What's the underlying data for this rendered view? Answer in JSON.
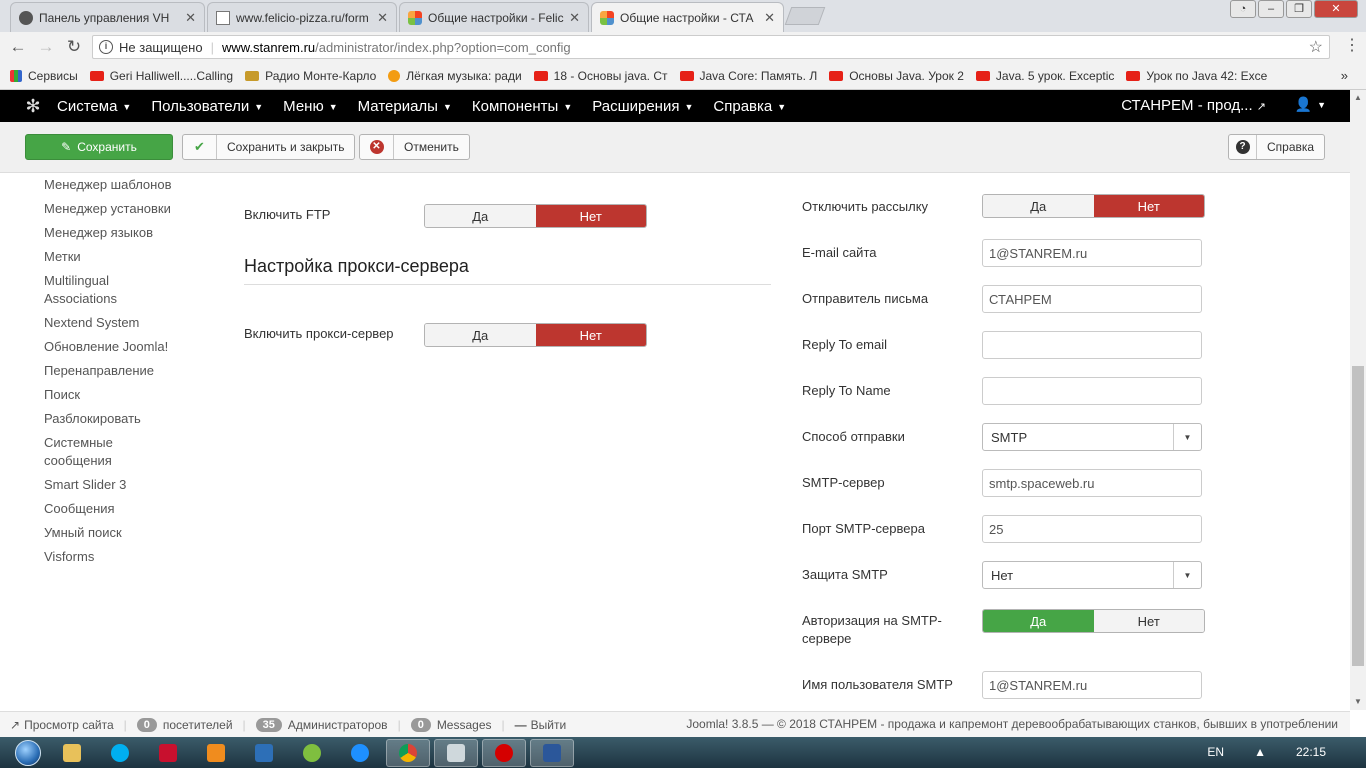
{
  "browser": {
    "tabs": [
      {
        "title": "Панель управления VH",
        "icon": "gear-icon",
        "active": false
      },
      {
        "title": "www.felicio-pizza.ru/form",
        "icon": "page-icon",
        "active": false
      },
      {
        "title": "Общие настройки - Felic",
        "icon": "joomla-icon",
        "active": false
      },
      {
        "title": "Общие настройки - СТА",
        "icon": "joomla-icon",
        "active": true
      }
    ],
    "address": {
      "security_label": "Не защищено",
      "host": "www.stanrem.ru",
      "path": "/administrator/index.php?option=com_config"
    },
    "bookmarks": [
      {
        "label": "Сервисы",
        "icon": "apps-icon"
      },
      {
        "label": "Geri Halliwell.....Calling",
        "icon": "youtube-icon"
      },
      {
        "label": "Радио Монте-Карло",
        "icon": "crown-icon"
      },
      {
        "label": "Лёгкая музыка: ради",
        "icon": "music-icon"
      },
      {
        "label": "18 - Основы java. Ст",
        "icon": "youtube-icon"
      },
      {
        "label": "Java Core: Память. Л",
        "icon": "youtube-icon"
      },
      {
        "label": "Основы Java. Урок 2",
        "icon": "youtube-icon"
      },
      {
        "label": "Java. 5 урок. Exceptic",
        "icon": "youtube-icon"
      },
      {
        "label": "Урок по Java 42: Exce",
        "icon": "youtube-icon"
      }
    ],
    "bookmarks_more": "»"
  },
  "joomla": {
    "menu": [
      "Система",
      "Пользователи",
      "Меню",
      "Материалы",
      "Компоненты",
      "Расширения",
      "Справка"
    ],
    "site_name": "СТАНРЕМ - прод...",
    "toolbar": {
      "save": "Сохранить",
      "save_close": "Сохранить и закрыть",
      "cancel": "Отменить",
      "help": "Справка"
    },
    "sidebar": [
      "Менеджер шаблонов",
      "Менеджер установки",
      "Менеджер языков",
      "Метки",
      "Multilingual Associations",
      "Nextend System",
      "Обновление Joomla!",
      "Перенаправление",
      "Поиск",
      "Разблокировать",
      "Системные сообщения",
      "Smart Slider 3",
      "Сообщения",
      "Умный поиск",
      "Visforms"
    ],
    "ftp": {
      "label": "Включить FTP",
      "yes": "Да",
      "no": "Нет",
      "value": "Нет"
    },
    "proxy_section_title": "Настройка прокси-сервера",
    "proxy": {
      "label": "Включить прокси-сервер",
      "yes": "Да",
      "no": "Нет",
      "value": "Нет"
    },
    "mail": {
      "disable_mail": {
        "label": "Отключить рассылку",
        "yes": "Да",
        "no": "Нет",
        "value": "Нет"
      },
      "site_email": {
        "label": "E-mail сайта",
        "value": "1@STANREM.ru"
      },
      "from_name": {
        "label": "Отправитель письма",
        "value": "СТАНРЕМ"
      },
      "reply_to_email": {
        "label": "Reply To email",
        "value": ""
      },
      "reply_to_name": {
        "label": "Reply To Name",
        "value": ""
      },
      "mailer": {
        "label": "Способ отправки",
        "value": "SMTP"
      },
      "smtp_host": {
        "label": "SMTP-сервер",
        "value": "smtp.spaceweb.ru"
      },
      "smtp_port": {
        "label": "Порт SMTP-сервера",
        "value": "25"
      },
      "smtp_secure": {
        "label": "Защита SMTP",
        "value": "Нет"
      },
      "smtp_auth": {
        "label_1": "Авторизация на SMTP-",
        "label_2": "сервере",
        "yes": "Да",
        "no": "Нет",
        "value": "Да"
      },
      "smtp_user": {
        "label": "Имя пользователя SMTP",
        "value": "1@STANREM.ru"
      }
    },
    "status": {
      "view_site": "Просмотр сайта",
      "visitors_count": "0",
      "visitors_label": "посетителей",
      "admins_count": "35",
      "admins_label": "Администраторов",
      "messages_count": "0",
      "messages_label": "Messages",
      "logout": "Выйти",
      "footer": "Joomla! 3.8.5  —  © 2018 СТАНРЕМ - продажа и капремонт деревообрабатывающих станков, бывших в употреблении"
    }
  },
  "taskbar": {
    "apps": [
      "explorer-icon",
      "skype-icon",
      "pdf-icon",
      "media-player-icon",
      "notes-icon",
      "dreamweaver-icon",
      "ie-icon",
      "chrome-icon",
      "network-icon",
      "opera-icon",
      "word-icon"
    ],
    "language": "EN",
    "time": "22:15"
  },
  "colors": {
    "green": "#46a546",
    "red": "#bd362f",
    "navbar": "#000000"
  }
}
